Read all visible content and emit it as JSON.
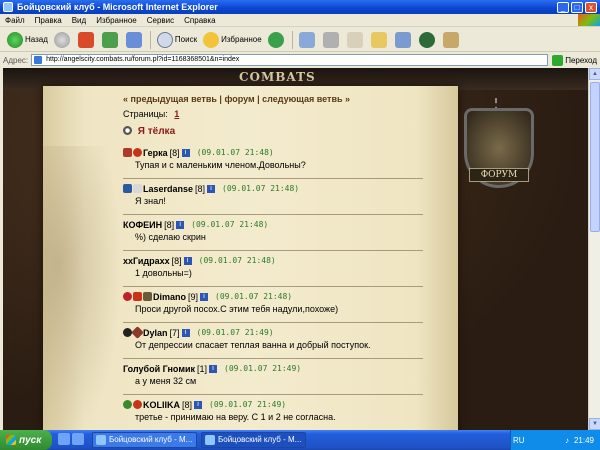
{
  "window": {
    "title": "Бойцовский клуб - Microsoft Internet Explorer",
    "minimize": "_",
    "maximize": "□",
    "close": "x"
  },
  "menu": [
    "Файл",
    "Правка",
    "Вид",
    "Избранное",
    "Сервис",
    "Справка"
  ],
  "toolbar": {
    "back_label": "Назад",
    "search_label": "Поиск",
    "favorites_label": "Избранное"
  },
  "address": {
    "label": "Адрес:",
    "url": "http://angelscity.combats.ru/forum.pl?id=1168368501&n=index",
    "go_label": "Переход"
  },
  "site": {
    "logo": "COMBATS",
    "emblem_label": "ФОРУМ"
  },
  "nav": {
    "prev": "« предыдущая ветвь",
    "sep1": " | ",
    "forum": "форум",
    "sep2": " | ",
    "next": "следующая ветвь »"
  },
  "pages": {
    "label": "Страницы:",
    "current": "1"
  },
  "thread": {
    "title": "Я тёлка"
  },
  "posts": [
    {
      "name": "Герка",
      "level": "[8]",
      "time": "(09.01.07 21:48)",
      "text": "Тупая и с маленьким членом.Довольны?"
    },
    {
      "name": "Laserdanse",
      "level": "[8]",
      "time": "(09.01.07 21:48)",
      "text": "Я знал!"
    },
    {
      "name": "КОФЕИН",
      "level": "[8]",
      "time": "(09.01.07 21:48)",
      "text": "%) сделаю скрин"
    },
    {
      "name": "xxГидраxx",
      "level": "[8]",
      "time": "(09.01.07 21:48)",
      "text": "1 довольны=)"
    },
    {
      "name": "Dimano",
      "level": "[9]",
      "time": "(09.01.07 21:48)",
      "text": "Проси другой посох.С этим тебя надули,похоже)"
    },
    {
      "name": "Dylan",
      "level": "[7]",
      "time": "(09.01.07 21:49)",
      "text": "От депрессии спасает теплая ванна и добрый поступок."
    },
    {
      "name": "Голубой Гномик",
      "level": "[1]",
      "time": "(09.01.07 21:49)",
      "text": "а у меня 32 см"
    },
    {
      "name": "KOLIIKA",
      "level": "[8]",
      "time": "(09.01.07 21:49)",
      "text": "третье - принимаю на веру. С 1 и 2 не согласна."
    }
  ],
  "taskbar": {
    "start": "пуск",
    "tasks": [
      "Бойцовский клуб - M...",
      "Бойцовский клуб - M..."
    ],
    "lang": "RU",
    "clock": "21:49"
  }
}
